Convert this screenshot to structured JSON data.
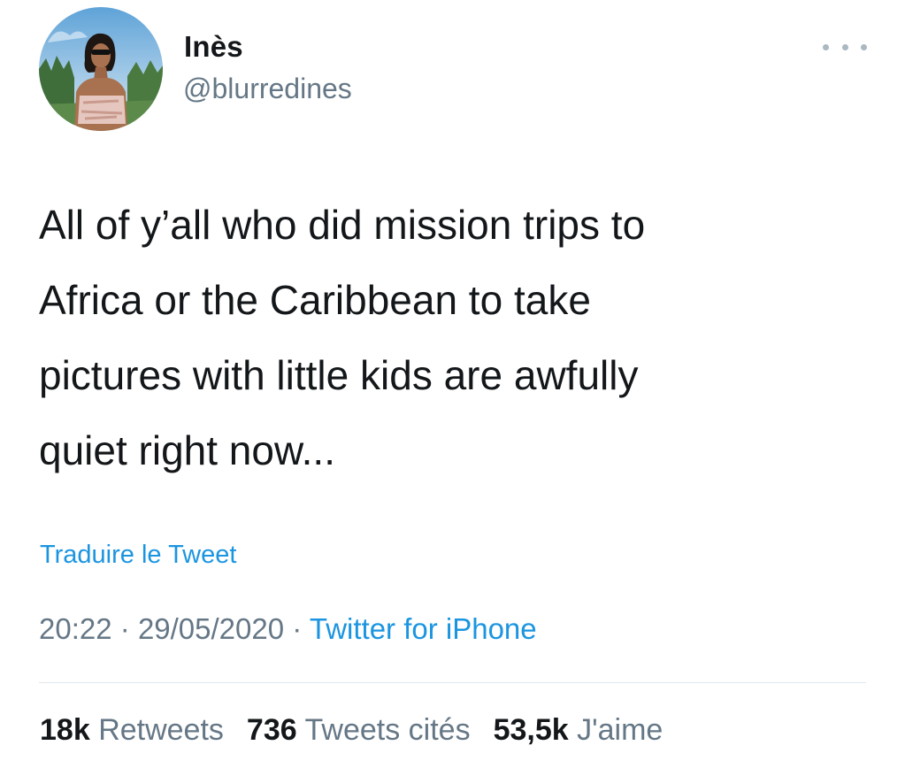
{
  "author": {
    "display_name": "Inès",
    "handle": "@blurredines"
  },
  "tweet": {
    "lines": [
      "All of y’all who did mission trips to",
      "Africa or the Caribbean to take",
      "pictures with little kids are awfully",
      "quiet right now..."
    ],
    "translate_label": "Traduire le Tweet",
    "time": "20:22",
    "separator": "·",
    "date": "29/05/2020",
    "source": "Twitter for iPhone"
  },
  "stats": {
    "retweets": {
      "count": "18k",
      "label": "Retweets"
    },
    "quotes": {
      "count": "736",
      "label": "Tweets cités"
    },
    "likes": {
      "count": "53,5k",
      "label": "J'aime"
    }
  },
  "icons": {
    "more": "more-horizontal-icon",
    "avatar": "user-avatar-photo"
  },
  "colors": {
    "text_primary": "#14171a",
    "text_secondary": "#657786",
    "link": "#1b95e0",
    "divider": "#e1e8ed"
  }
}
